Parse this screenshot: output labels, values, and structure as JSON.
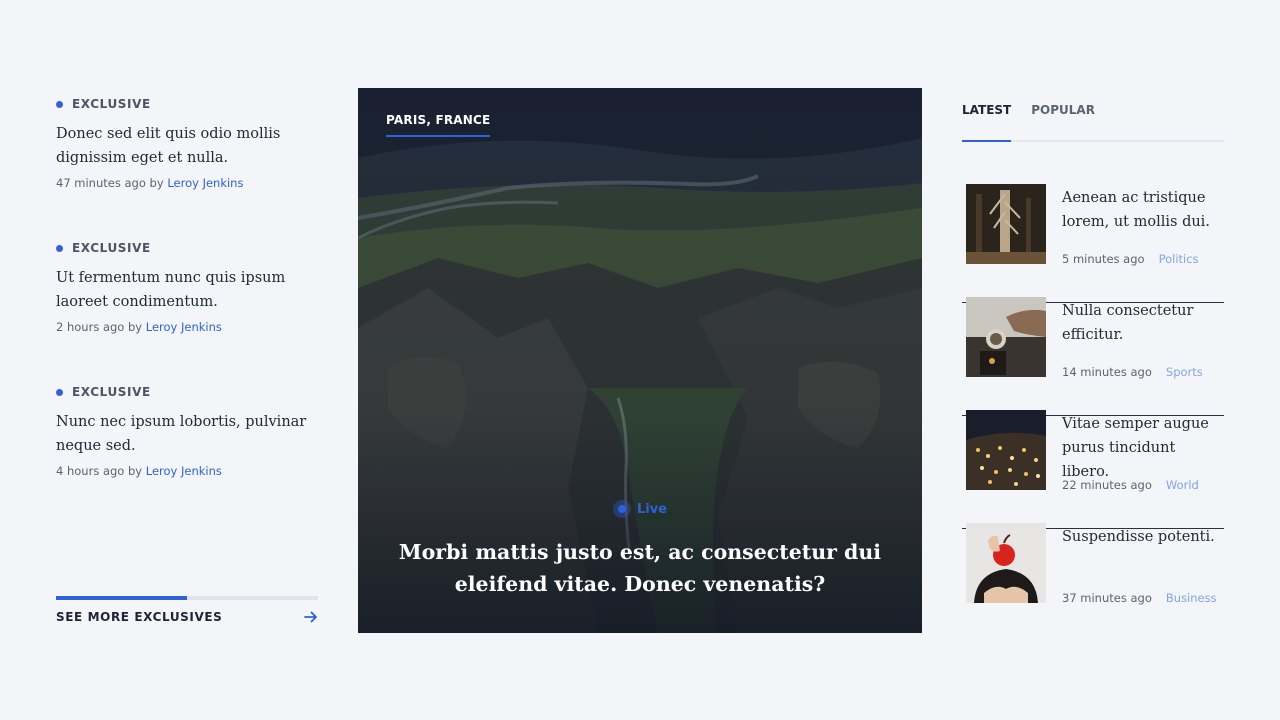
{
  "exclusives": [
    {
      "tag": "EXCLUSIVE",
      "title": "Donec sed elit quis odio mollis dignissim eget et nulla.",
      "time": "47 minutes ago",
      "by": "by",
      "author": "Leroy Jenkins"
    },
    {
      "tag": "EXCLUSIVE",
      "title": "Ut fermentum nunc quis ipsum laoreet condimentum.",
      "time": "2 hours ago",
      "by": "by",
      "author": "Leroy Jenkins"
    },
    {
      "tag": "EXCLUSIVE",
      "title": "Nunc nec ipsum lobortis, pulvinar neque sed.",
      "time": "4 hours ago",
      "by": "by",
      "author": "Leroy Jenkins"
    }
  ],
  "see_more": {
    "label": "SEE MORE EXCLUSIVES",
    "progress": 0.5
  },
  "hero": {
    "location": "PARIS, FRANCE",
    "live_label": "Live",
    "headline": "Morbi mattis justo est, ac consectetur dui eleifend vitae. Donec venenatis?"
  },
  "tabs": [
    {
      "label": "LATEST",
      "active": true
    },
    {
      "label": "POPULAR",
      "active": false
    }
  ],
  "news": [
    {
      "title": "Aenean ac tristique lorem, ut mollis dui.",
      "time": "5 minutes ago",
      "category": "Politics"
    },
    {
      "title": "Nulla consectetur efficitur.",
      "time": "14 minutes ago",
      "category": "Sports"
    },
    {
      "title": "Vitae semper augue purus tincidunt libero.",
      "time": "22 minutes ago",
      "category": "World"
    },
    {
      "title": "Suspendisse potenti.",
      "time": "37 minutes ago",
      "category": "Business"
    }
  ],
  "colors": {
    "accent": "#2d62d6",
    "category": "#7fa6e6",
    "background": "#f3f5f8"
  },
  "icons": {
    "tag_dot": "dot-icon",
    "see_more": "arrow-right-icon",
    "live": "live-icon"
  }
}
